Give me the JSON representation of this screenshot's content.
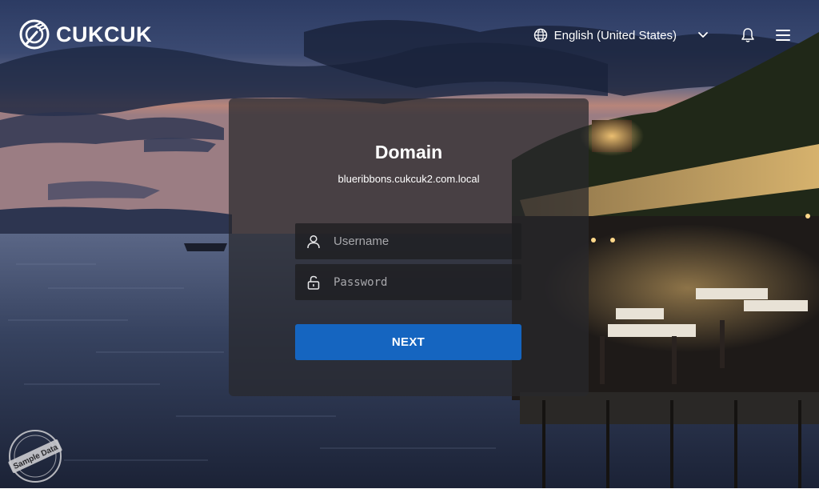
{
  "brand": {
    "name": "CUKCUK",
    "icon": "fork-logo-icon"
  },
  "topbar": {
    "language": "English (United States)",
    "language_icon": "globe-icon",
    "chevron_icon": "chevron-down-icon",
    "notification_icon": "bell-icon",
    "menu_icon": "hamburger-menu-icon"
  },
  "login": {
    "title": "Domain",
    "domain": "blueribbons.cukcuk2.com.local",
    "username_placeholder": "Username",
    "password_placeholder": "Password",
    "next_label": "NEXT"
  },
  "watermark": {
    "text": "Sample Data"
  },
  "colors": {
    "primary": "#1565c0",
    "card_bg": "#28282c",
    "text": "#ffffff"
  }
}
